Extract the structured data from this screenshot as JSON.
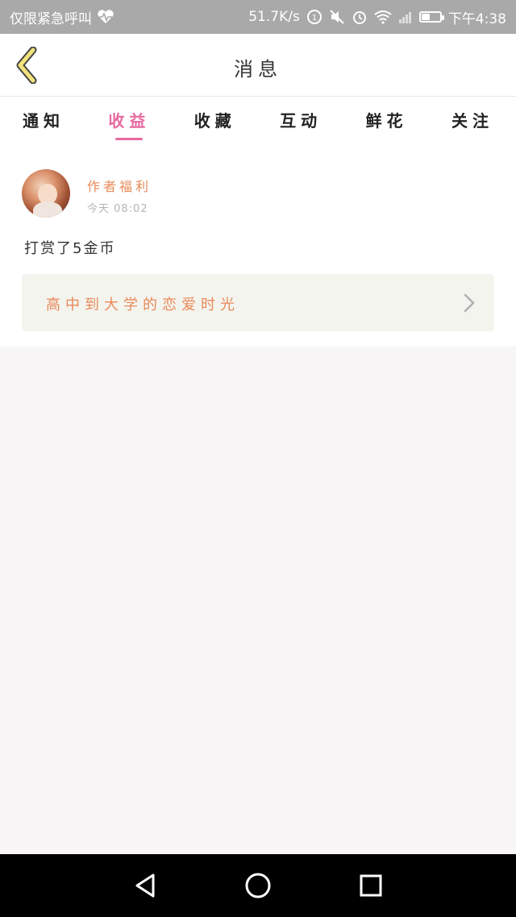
{
  "status_bar": {
    "carrier": "仅限紧急呼叫",
    "network_speed": "51.7K/s",
    "time": "下午4:38",
    "battery_level": 0.45,
    "icons": [
      "heart-rate-icon",
      "data-saver-icon",
      "mute-icon",
      "alarm-icon",
      "wifi-icon",
      "signal-icon",
      "battery-icon"
    ]
  },
  "header": {
    "title": "消息",
    "back_icon": "chevron-left-icon"
  },
  "tabs": [
    {
      "label": "通知",
      "active": false
    },
    {
      "label": "收益",
      "active": true
    },
    {
      "label": "收藏",
      "active": false
    },
    {
      "label": "互动",
      "active": false
    },
    {
      "label": "鲜花",
      "active": false
    },
    {
      "label": "关注",
      "active": false
    }
  ],
  "message": {
    "author": "作者福利",
    "time": "今天 08:02",
    "text": "打赏了5金币",
    "book_title": "高中到大学的恋爱时光"
  },
  "colors": {
    "accent_pink": "#e76aa0",
    "accent_orange": "#e88a58",
    "back_icon_yellow": "#f2e27a",
    "status_bar_bg": "#a9a9a9"
  },
  "nav_bar": {
    "icons": [
      "back-triangle-icon",
      "home-circle-icon",
      "recents-square-icon"
    ]
  }
}
